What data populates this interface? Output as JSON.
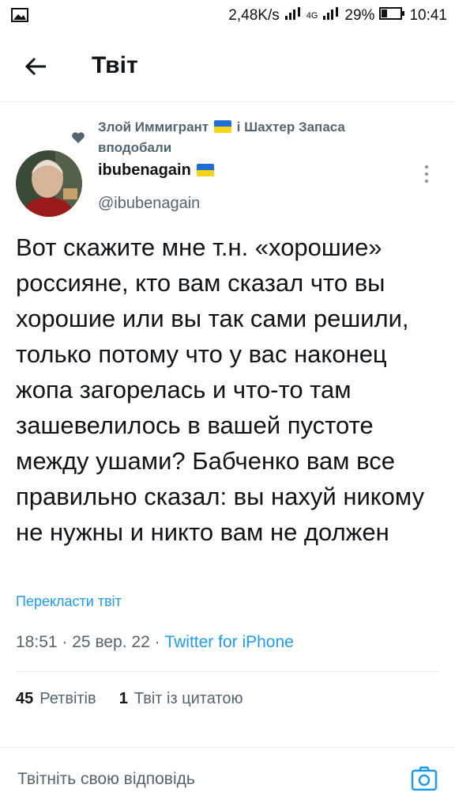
{
  "status_bar": {
    "speed": "2,48K/s",
    "network_label": "4G",
    "battery": "29%",
    "time": "10:41",
    "icons": [
      "image-icon",
      "signal-icon",
      "battery-icon"
    ]
  },
  "header": {
    "title": "Твіт",
    "back_icon": "arrow-left-icon"
  },
  "liked_by": {
    "user1": "Злой Иммигрант",
    "conj": "і",
    "user2": "Шахтер Запаса",
    "action": "вподобали"
  },
  "author": {
    "name": "ibubenagain",
    "handle": "@ibubenagain"
  },
  "tweet": {
    "text": "Вот скажите мне т.н. «хорошие» россияне, кто вам сказал что вы хорошие или вы так сами решили, только потому что у вас наконец жопа загорелась и что-то там зашевелилось в вашей пустоте между ушами? Бабченко вам все правильно сказал: вы нахуй никому не нужны и никто вам не должен",
    "translate_label": "Перекласти твіт",
    "time": "18:51",
    "date": "25 вер. 22",
    "source": "Twitter for iPhone",
    "separator": "·"
  },
  "stats": {
    "retweets_count": "45",
    "retweets_label": "Ретвітів",
    "quotes_count": "1",
    "quotes_label": "Твіт із цитатою"
  },
  "reply": {
    "placeholder": "Твітніть свою відповідь"
  },
  "colors": {
    "accent": "#1d9bf0",
    "secondary_text": "#536471",
    "flag_blue": "#1d6fd6",
    "flag_yellow": "#f9d316"
  }
}
